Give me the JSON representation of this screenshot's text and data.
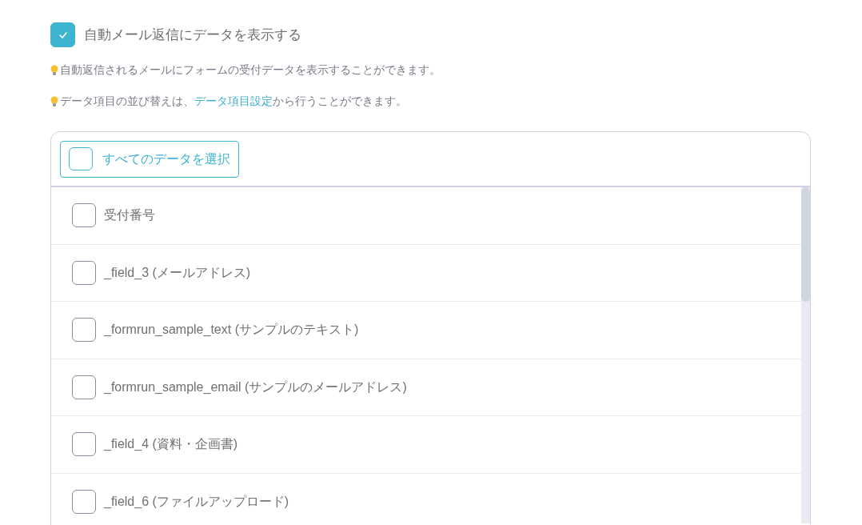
{
  "show_data": {
    "label": "自動メール返信にデータを表示する",
    "checked": true
  },
  "hints": [
    {
      "before": "自動返信されるメールにフォームの受付データを表示することができます。"
    },
    {
      "before": "データ項目の並び替えは、",
      "link": "データ項目設定",
      "after": "から行うことができます。"
    }
  ],
  "select_all": {
    "label": "すべてのデータを選択",
    "checked": false
  },
  "fields": [
    {
      "label": "受付番号",
      "checked": false
    },
    {
      "label": "_field_3 (メールアドレス)",
      "checked": false
    },
    {
      "label": "_formrun_sample_text (サンプルのテキスト)",
      "checked": false
    },
    {
      "label": "_formrun_sample_email (サンプルのメールアドレス)",
      "checked": false
    },
    {
      "label": "_field_4 (資料・企画書)",
      "checked": false
    },
    {
      "label": "_field_6 (ファイルアップロード)",
      "checked": false
    }
  ]
}
